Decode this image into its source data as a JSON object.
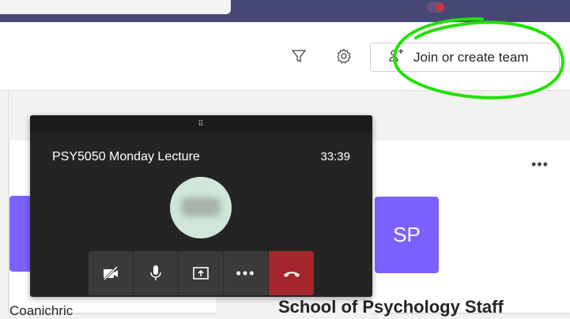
{
  "header": {
    "join_label": "Join or create team"
  },
  "teams": {
    "left_card_name": "Coanichric",
    "right_card_initials": "SP",
    "right_card_name": "School of Psychology Staff"
  },
  "call": {
    "title": "PSY5050 Monday Lecture",
    "timer": "33:39",
    "drag_handle": "⠿",
    "controls": [
      "camera-off",
      "microphone",
      "share-screen",
      "more",
      "hang-up"
    ]
  },
  "colors": {
    "brand": "#464775",
    "tile": "#7b61ff",
    "hangup": "#a4262c",
    "annotation": "#22e000"
  },
  "icons": [
    "filter-icon",
    "settings-icon",
    "people-add-icon",
    "more-icon"
  ]
}
